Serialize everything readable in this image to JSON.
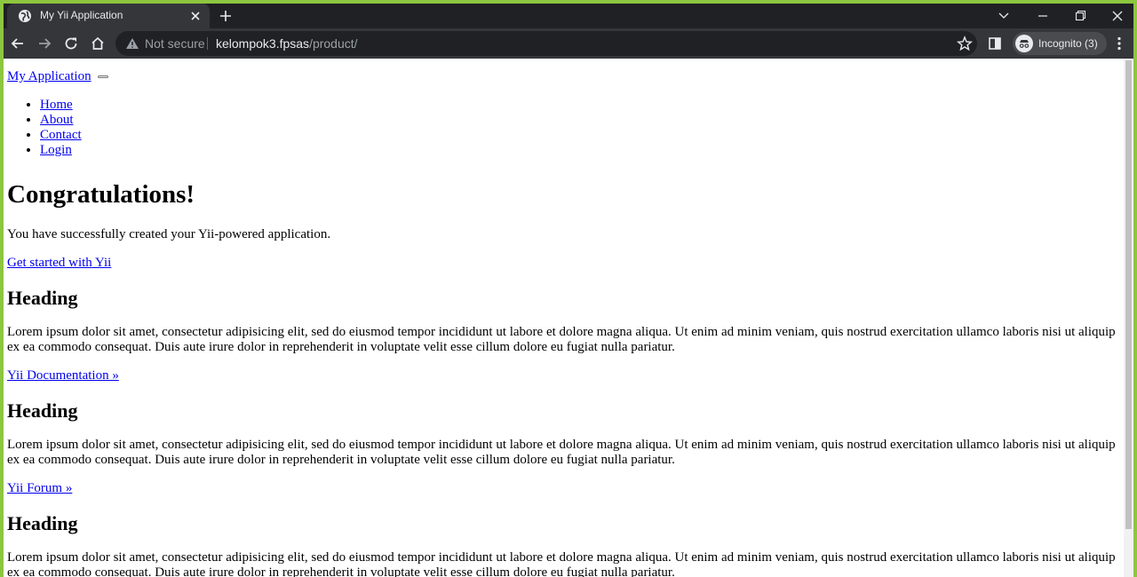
{
  "browser": {
    "tab_title": "My Yii Application",
    "omnibox": {
      "security_text": "Not secure",
      "host": "kelompok3.fpsas",
      "path": "/product/"
    },
    "incognito_label": "Incognito (3)"
  },
  "page": {
    "brand": "My Application",
    "nav": [
      {
        "label": "Home"
      },
      {
        "label": "About"
      },
      {
        "label": "Contact"
      },
      {
        "label": "Login"
      }
    ],
    "jumbotron": {
      "title": "Congratulations!",
      "lead": "You have successfully created your Yii-powered application.",
      "cta": "Get started with Yii"
    },
    "sections": [
      {
        "heading": "Heading",
        "text": "Lorem ipsum dolor sit amet, consectetur adipisicing elit, sed do eiusmod tempor incididunt ut labore et dolore magna aliqua. Ut enim ad minim veniam, quis nostrud exercitation ullamco laboris nisi ut aliquip ex ea commodo consequat. Duis aute irure dolor in reprehenderit in voluptate velit esse cillum dolore eu fugiat nulla pariatur.",
        "link": "Yii Documentation »"
      },
      {
        "heading": "Heading",
        "text": "Lorem ipsum dolor sit amet, consectetur adipisicing elit, sed do eiusmod tempor incididunt ut labore et dolore magna aliqua. Ut enim ad minim veniam, quis nostrud exercitation ullamco laboris nisi ut aliquip ex ea commodo consequat. Duis aute irure dolor in reprehenderit in voluptate velit esse cillum dolore eu fugiat nulla pariatur.",
        "link": "Yii Forum »"
      },
      {
        "heading": "Heading",
        "text": "Lorem ipsum dolor sit amet, consectetur adipisicing elit, sed do eiusmod tempor incididunt ut labore et dolore magna aliqua. Ut enim ad minim veniam, quis nostrud exercitation ullamco laboris nisi ut aliquip ex ea commodo consequat. Duis aute irure dolor in reprehenderit in voluptate velit esse cillum dolore eu fugiat nulla pariatur."
      }
    ]
  },
  "colors": {
    "window_border": "#8dc63f",
    "chrome_dark": "#202124",
    "chrome_toolbar": "#35363a",
    "link": "#0000ee"
  }
}
